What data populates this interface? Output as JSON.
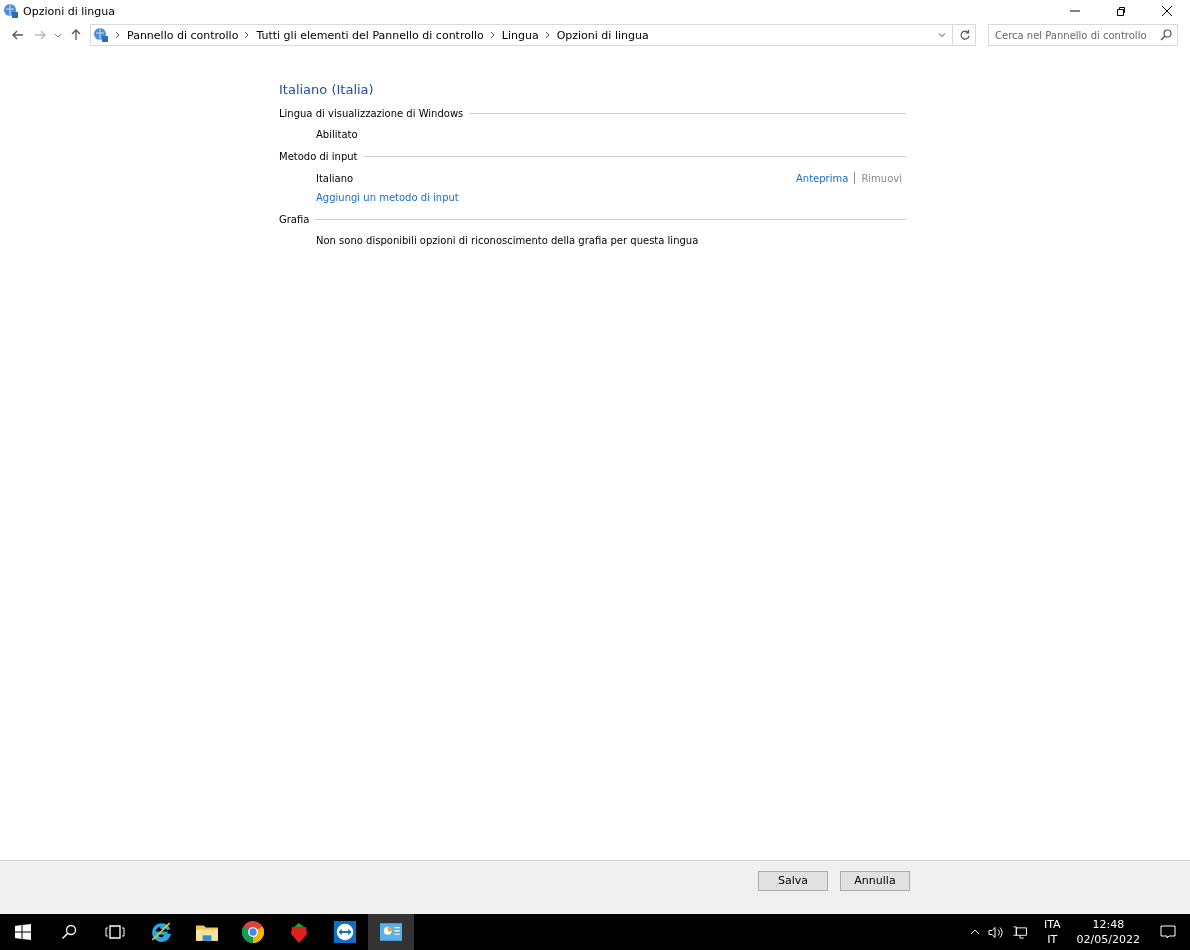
{
  "window": {
    "title": "Opzioni di lingua"
  },
  "address_bar": {
    "breadcrumbs": [
      "Pannello di controllo",
      "Tutti gli elementi del Pannello di controllo",
      "Lingua",
      "Opzioni di lingua"
    ],
    "search": {
      "placeholder": "Cerca nel Pannello di controllo"
    }
  },
  "heading": "Italiano (Italia)",
  "sections": [
    {
      "title": "Lingua di visualizzazione di Windows",
      "kind": "text",
      "items": [
        {
          "text": "Abilitato"
        }
      ]
    },
    {
      "title": "Metodo di input",
      "kind": "methods",
      "items": [
        {
          "text": "Italiano",
          "actions": [
            {
              "label": "Anteprima",
              "disabled": false
            },
            {
              "label": "Rimuovi",
              "disabled": true
            }
          ]
        }
      ],
      "add_link": "Aggiungi un metodo di input"
    },
    {
      "title": "Grafia",
      "kind": "text",
      "items": [
        {
          "text": "Non sono disponibili opzioni di riconoscimento della grafia per questa lingua"
        }
      ]
    }
  ],
  "buttons": [
    "Salva",
    "Annulla"
  ],
  "taskbar": {
    "apps": [
      {
        "kind": "start",
        "selected": false
      },
      {
        "kind": "search",
        "selected": false
      },
      {
        "kind": "taskview",
        "selected": false
      },
      {
        "kind": "ie",
        "selected": false
      },
      {
        "kind": "explorer",
        "selected": false
      },
      {
        "kind": "chrome",
        "selected": false
      },
      {
        "kind": "strawberry",
        "selected": false
      },
      {
        "kind": "teamviewer",
        "selected": false
      },
      {
        "kind": "controlpanel",
        "selected": true
      }
    ],
    "language": [
      "ITA",
      "IT"
    ],
    "time": "12:48",
    "date": "02/05/2022"
  }
}
